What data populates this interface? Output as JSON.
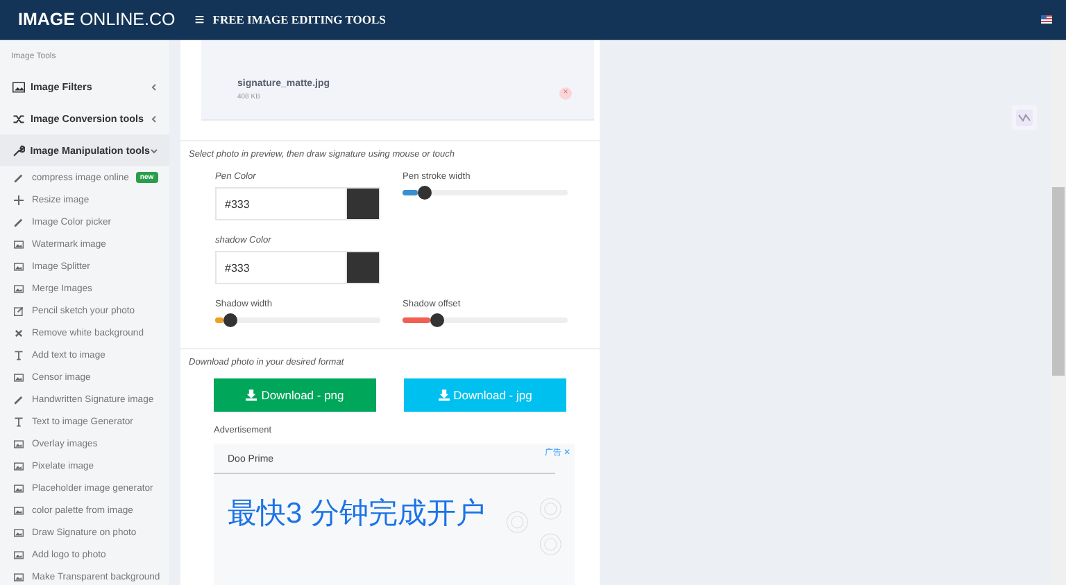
{
  "header": {
    "logo_bold": "IMAGE",
    "logo_rest": "ONLINE.CO",
    "menu_icon": "≡",
    "nav_title": "FREE IMAGE EDITING TOOLS"
  },
  "sidebar": {
    "heading": "Image Tools",
    "sections": [
      {
        "label": "Image Filters",
        "expanded": false
      },
      {
        "label": "Image Conversion tools",
        "expanded": false
      },
      {
        "label": "Image Manipulation tools",
        "expanded": true,
        "children": [
          {
            "label": "compress image online",
            "badge": "new"
          },
          {
            "label": "Resize image"
          },
          {
            "label": "Image Color picker"
          },
          {
            "label": "Watermark image"
          },
          {
            "label": "Image Splitter"
          },
          {
            "label": "Merge Images"
          },
          {
            "label": "Pencil sketch your photo"
          },
          {
            "label": "Remove white background"
          },
          {
            "label": "Add text to image"
          },
          {
            "label": "Censor image"
          },
          {
            "label": "Handwritten Signature image"
          },
          {
            "label": "Text to image Generator"
          },
          {
            "label": "Overlay images"
          },
          {
            "label": "Pixelate image"
          },
          {
            "label": "Placeholder image generator"
          },
          {
            "label": "color palette from image"
          },
          {
            "label": "Draw Signature on photo"
          },
          {
            "label": "Add logo to photo"
          },
          {
            "label": "Make Transparent background"
          }
        ]
      }
    ]
  },
  "file": {
    "name": "signature_matte.jpg",
    "size": "408 KB",
    "remove": "×"
  },
  "instruction": "Select photo in preview, then draw signature using mouse or touch",
  "pen_color": {
    "label": "Pen Color",
    "value": "#333"
  },
  "pen_stroke": {
    "label": "Pen stroke width",
    "level": 0.09,
    "color": "#3a8fd0"
  },
  "shadow_color": {
    "label": "shadow Color",
    "value": "#333"
  },
  "shadow_width": {
    "label": "Shadow width",
    "level": 0.05,
    "color": "#f0a020"
  },
  "shadow_offset": {
    "label": "Shadow offset",
    "level": 0.17,
    "color": "#f06050"
  },
  "download_hint": "Download photo in your desired format",
  "buttons": [
    {
      "label": "Download - png",
      "kind": "png"
    },
    {
      "label": "Download - jpg",
      "kind": "jpg"
    }
  ],
  "advertisement": {
    "label": "Advertisement",
    "ad_mark": "广告",
    "close": "✕",
    "sponsor": "Doo Prime",
    "headline": "最快3 分钟完成开户"
  }
}
